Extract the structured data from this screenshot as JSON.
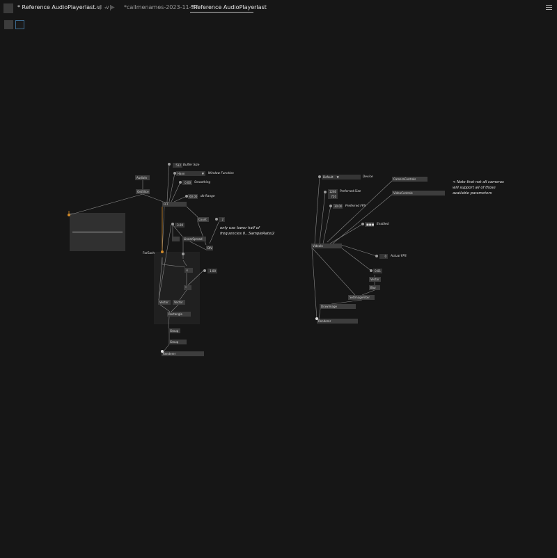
{
  "tabs": [
    {
      "label": "* Reference AudioPlayerlast.vl",
      "suffix": "∨|"
    },
    {
      "label": "*callmenames-2023-11-27"
    },
    {
      "label": "*Reference AudioPlayerlast"
    }
  ],
  "nav": {
    "back_icon": "◀",
    "forward_icon": "▶",
    "dropdown_icon": "▾"
  },
  "patch": {
    "audio": {
      "audioin": "AudioIn",
      "getslice": "GetSlice",
      "fft": "FFT",
      "buffer_size_value": "512",
      "buffer_size_label": "Buffer Size",
      "window_function_value": "Hann",
      "window_function_label": "Window Function",
      "smoothing_value": "0.00",
      "smoothing_label": "Smoothing",
      "db_range_value": "60.00",
      "db_range_label": "db Range",
      "count": "Count",
      "count_divisor": "2",
      "div": "DIV",
      "width_value": "3.00",
      "linearspread": "LinearSpread",
      "comment_line1": "only use lower half of",
      "comment_line2": "frequencies 0...SampleRate/2",
      "foreach": "ForEach",
      "mul_a": "×",
      "mul_b": "*",
      "height_value": "1.00",
      "vector_a": "Vector",
      "vector_b": "Vector",
      "rectangle": "Rectangle",
      "group_a": "Group",
      "group_b": "Group",
      "renderer": "Renderer"
    },
    "video": {
      "device_value": "Default",
      "device_label": "Device",
      "camera_controls": "CameraControls",
      "video_controls": "VideoControls",
      "note_line1": "< Note that not all cameras",
      "note_line2": "will support all of those",
      "note_line3": "available parameters",
      "size_w": "1280",
      "size_h": "720",
      "preferred_size_label": "Preferred Size",
      "fps_value": "30.00",
      "preferred_fps_label": "Preferred FPS",
      "enabled_value": "■■■",
      "enabled_label": "Enabled",
      "videoin": "VideoIn",
      "actual_fps_value": "0",
      "actual_fps_label": "Actual FPS",
      "blur_value": "0.01",
      "vector": "Vector",
      "blur": "Blur",
      "setimagefilter": "SetImageFilter",
      "drawimage": "DrawImage",
      "renderer": "Renderer"
    }
  },
  "colors": {
    "background": "#161616",
    "node": "#3d3d3d",
    "link": "#8a8a8a",
    "accent_orange": "#d08a2a",
    "tab_outline": "#3d6a8e"
  }
}
